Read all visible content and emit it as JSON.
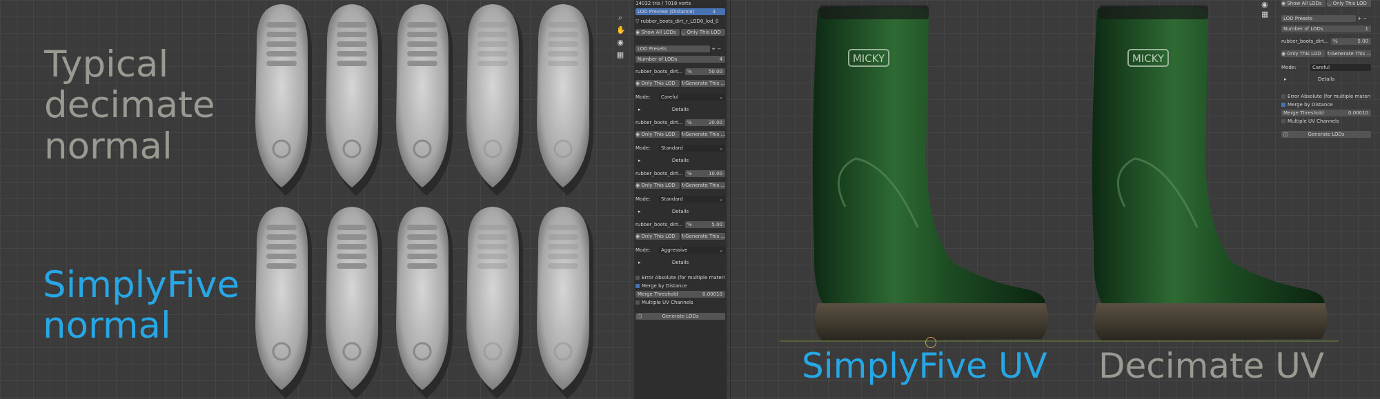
{
  "left_labels": {
    "typical": [
      "Typical",
      "decimate",
      "normal"
    ],
    "simplyfive": [
      "SimplyFive",
      "normal"
    ]
  },
  "bottom_labels": {
    "simplyfive_uv": "SimplyFive UV",
    "decimate_uv": "Decimate UV"
  },
  "boot_logo": "MICKY",
  "colors": {
    "gray_label": "#9a9a92",
    "blue_label": "#27a7e6",
    "panel_bg": "#2e2e2e",
    "accent": "#4772b3"
  },
  "toolbar_icons": [
    "zoom-icon",
    "hand-pan-icon",
    "camera-icon",
    "grid-icon"
  ],
  "panel": {
    "stats": "14032 tris / 7018 verts",
    "lod_preview": "LOD Preview (Distance)",
    "lod_preview_value": "3",
    "source_object": "rubber_boots_dirt_r_LOD0_lod_0",
    "show_all": "Show All LODs",
    "only_this": "Only This LOD",
    "presets": "LOD Presets",
    "num_lods_label": "Number of LODs",
    "num_lods": "4",
    "lods": [
      {
        "name": "rubber_boots_dirt...",
        "pct_symbol": "%",
        "pct": "50.00",
        "only": "Only This LOD",
        "gen": "Generate This ...",
        "mode_label": "Mode:",
        "mode": "Careful",
        "details": "Details"
      },
      {
        "name": "rubber_boots_dirt...",
        "pct_symbol": "%",
        "pct": "20.00",
        "only": "Only This LOD",
        "gen": "Generate This ...",
        "mode_label": "Mode:",
        "mode": "Standard",
        "details": "Details"
      },
      {
        "name": "rubber_boots_dirt...",
        "pct_symbol": "%",
        "pct": "10.00",
        "only": "Only This LOD",
        "gen": "Generate This ...",
        "mode_label": "Mode:",
        "mode": "Standard",
        "details": "Details"
      },
      {
        "name": "rubber_boots_dirt...",
        "pct_symbol": "%",
        "pct": "5.00",
        "only": "Only This LOD",
        "gen": "Generate This ...",
        "mode_label": "Mode:",
        "mode": "Aggressive",
        "details": "Details"
      }
    ],
    "error_absolute": "Error Absolute (for multiple materials)",
    "merge_by_distance": "Merge by Distance",
    "merge_threshold_label": "Merge Threshold",
    "merge_threshold": "0.00010",
    "multiple_uv": "Multiple UV Channels",
    "generate": "Generate LODs"
  },
  "panel2": {
    "show_all": "Show All LODs",
    "only_this": "Only This LOD",
    "presets": "LOD Presets",
    "num_lods_label": "Number of LODs",
    "num_lods": "1",
    "lod_name": "rubber_boots_dirt...",
    "pct_symbol": "%",
    "pct": "5.00",
    "only": "Only This LOD",
    "gen": "Generate This ...",
    "mode_label": "Mode:",
    "mode": "Careful",
    "details": "Details",
    "error_absolute": "Error Absolute (for multiple materials)",
    "merge_by_distance": "Merge by Distance",
    "merge_threshold_label": "Merge Threshold",
    "merge_threshold": "0.00010",
    "multiple_uv": "Multiple UV Channels",
    "generate": "Generate LODs"
  }
}
